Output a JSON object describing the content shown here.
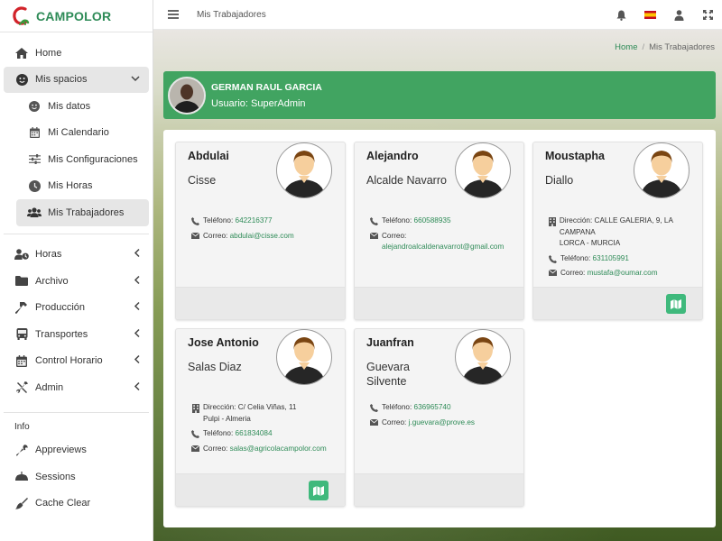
{
  "brand": {
    "name": "CAMPOLOR"
  },
  "sidebar": {
    "items": [
      {
        "label": "Home",
        "icon": "home-icon"
      },
      {
        "label": "Mis spacios",
        "icon": "smile-icon"
      }
    ],
    "submenu": [
      {
        "label": "Mis datos",
        "icon": "smile-icon"
      },
      {
        "label": "Mi Calendario",
        "icon": "calendar-icon"
      },
      {
        "label": "Mis Configuraciones",
        "icon": "sliders-icon"
      },
      {
        "label": "Mis Horas",
        "icon": "clock-icon"
      },
      {
        "label": "Mis Trabajadores",
        "icon": "users-icon"
      }
    ],
    "groups": [
      {
        "label": "Horas",
        "icon": "user-clock-icon"
      },
      {
        "label": "Archivo",
        "icon": "folder-icon"
      },
      {
        "label": "Producción",
        "icon": "hammer-icon"
      },
      {
        "label": "Transportes",
        "icon": "bus-icon"
      },
      {
        "label": "Control Horario",
        "icon": "calendar-icon"
      },
      {
        "label": "Admin",
        "icon": "tools-icon"
      }
    ],
    "info_header": "Info",
    "info_items": [
      {
        "label": "Appreviews",
        "icon": "wrench-icon"
      },
      {
        "label": "Sessions",
        "icon": "gauge-icon"
      },
      {
        "label": "Cache Clear",
        "icon": "broom-icon"
      }
    ]
  },
  "topbar": {
    "title": "Mis Trabajadores"
  },
  "breadcrumb": {
    "home": "Home",
    "current": "Mis Trabajadores"
  },
  "user": {
    "name": "GERMAN RAUL GARCIA",
    "role": "Usuario: SuperAdmin"
  },
  "labels": {
    "phone": "Teléfono:",
    "email": "Correo:",
    "address": "Dirección:"
  },
  "workers": [
    {
      "first": "Abdulai",
      "last": "Cisse",
      "phone": "642216377",
      "email": "abdulai@cisse.com"
    },
    {
      "first": "Alejandro",
      "last": "Alcalde Navarro",
      "phone": "660588935",
      "email": "alejandroalcaldenavarrot@gmail.com"
    },
    {
      "first": "Moustapha",
      "last": "Diallo",
      "address": "CALLE GALERIA, 9, LA CAMPANA",
      "city": "LORCA - MURCIA",
      "phone": "631105991",
      "email": "mustafa@oumar.com"
    },
    {
      "first": "Jose Antonio",
      "last": "Salas Diaz",
      "address": "C/ Celia Viñas, 11",
      "city": "Pulpi - Almeria",
      "phone": "661834084",
      "email": "salas@agricolacampolor.com"
    },
    {
      "first": "Juanfran",
      "last": "Guevara Silvente",
      "phone": "636965740",
      "email": "j.guevara@prove.es"
    }
  ],
  "colors": {
    "brand": "#2e8b57",
    "banner": "#41a461",
    "map_button": "#3fb97c"
  }
}
